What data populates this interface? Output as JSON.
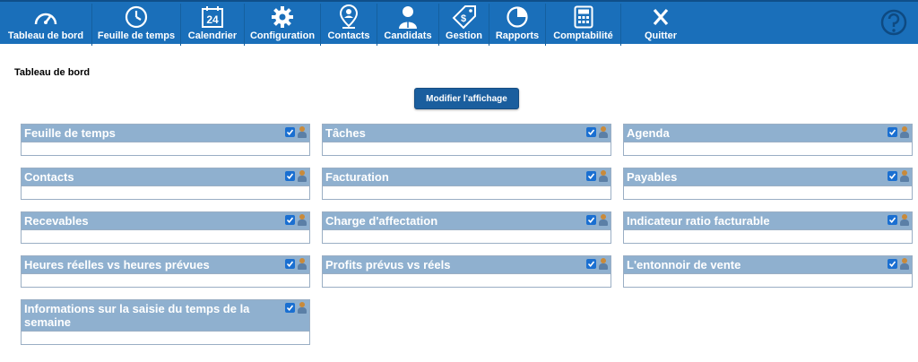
{
  "nav": {
    "items": [
      {
        "label": "Tableau de bord",
        "icon": "gauge-icon"
      },
      {
        "label": "Feuille de temps",
        "icon": "clock-icon"
      },
      {
        "label": "Calendrier",
        "icon": "calendar-icon",
        "day": "24"
      },
      {
        "label": "Configuration",
        "icon": "gear-icon"
      },
      {
        "label": "Contacts",
        "icon": "contact-pin-icon"
      },
      {
        "label": "Candidats",
        "icon": "person-icon"
      },
      {
        "label": "Gestion",
        "icon": "dollar-tag-icon"
      },
      {
        "label": "Rapports",
        "icon": "pie-chart-icon"
      },
      {
        "label": "Comptabilité",
        "icon": "calculator-icon"
      },
      {
        "label": "Quitter",
        "icon": "exit-x-icon"
      }
    ],
    "help_icon": "help-question-icon",
    "bar_color": "#1a6fba"
  },
  "main": {
    "title": "Tableau de bord",
    "modify_button": "Modifier l'affichage",
    "widgets": [
      {
        "title": "Feuille de temps",
        "checked": true
      },
      {
        "title": "Tâches",
        "checked": true
      },
      {
        "title": "Agenda",
        "checked": true
      },
      {
        "title": "Contacts",
        "checked": true
      },
      {
        "title": "Facturation",
        "checked": true
      },
      {
        "title": "Payables",
        "checked": true
      },
      {
        "title": "Recevables",
        "checked": true
      },
      {
        "title": "Charge d'affectation",
        "checked": true
      },
      {
        "title": "Indicateur ratio facturable",
        "checked": true
      },
      {
        "title": "Heures réelles vs heures prévues",
        "checked": true
      },
      {
        "title": "Profits prévus vs réels",
        "checked": true
      },
      {
        "title": "L'entonnoir de vente",
        "checked": true
      },
      {
        "title": "Informations sur la saisie du temps de la semaine",
        "checked": true
      }
    ]
  }
}
